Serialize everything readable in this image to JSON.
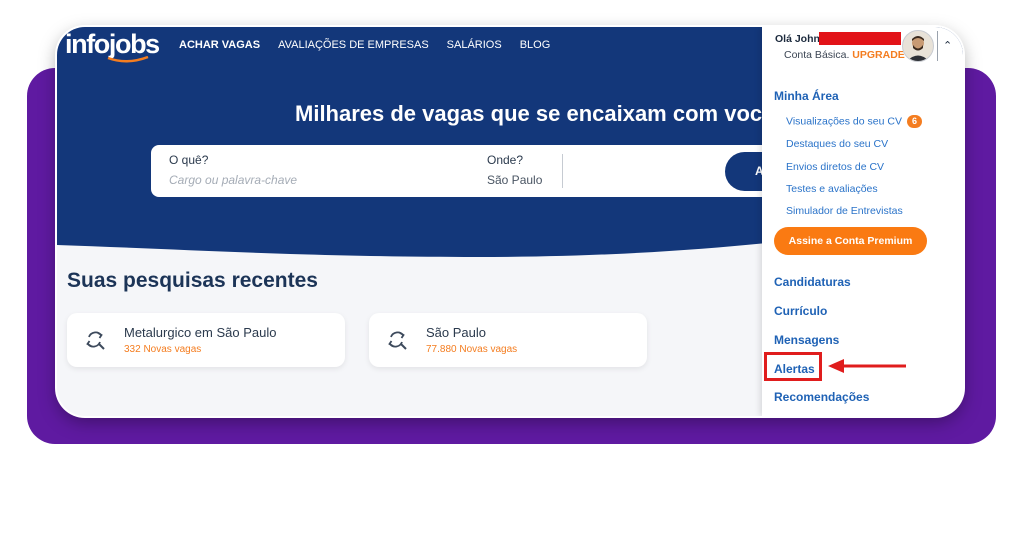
{
  "header": {
    "logo": "infojobs",
    "nav": [
      "ACHAR VAGAS",
      "AVALIAÇÕES DE EMPRESAS",
      "SALÁRIOS",
      "BLOG"
    ]
  },
  "hero": {
    "headline": "Milhares de vagas que se encaixam com você!",
    "search": {
      "what_label": "O quê?",
      "what_placeholder": "Cargo ou palavra-chave",
      "where_label": "Onde?",
      "where_value": "São Paulo",
      "button_label": "A"
    }
  },
  "recent": {
    "title": "Suas pesquisas recentes",
    "items": [
      {
        "title": "Metalurgico em São Paulo",
        "subtitle": "332 Novas vagas"
      },
      {
        "title": "São Paulo",
        "subtitle": "77.880 Novas vagas"
      }
    ]
  },
  "user_menu": {
    "greeting": "Olá John",
    "account_prefix": "Conta Básica.",
    "upgrade": "UPGRADE",
    "section_minha_area": "Minha Área",
    "items": [
      {
        "label": "Visualizações do seu CV",
        "badge": "6"
      },
      {
        "label": "Destaques do seu CV"
      },
      {
        "label": "Envios diretos de CV"
      },
      {
        "label": "Testes e avaliações"
      },
      {
        "label": "Simulador de Entrevistas"
      }
    ],
    "premium_button": "Assine a Conta Premium",
    "sections": [
      "Candidaturas",
      "Currículo",
      "Mensagens",
      "Alertas",
      "Recomendações"
    ]
  },
  "colors": {
    "navy": "#13377a",
    "orange": "#f47d20",
    "purple": "#5f1aa1",
    "link_blue": "#1f62b5",
    "annotation_red": "#e01d1d"
  },
  "icons": [
    "search-history-icon",
    "chevron-up-icon",
    "avatar"
  ]
}
